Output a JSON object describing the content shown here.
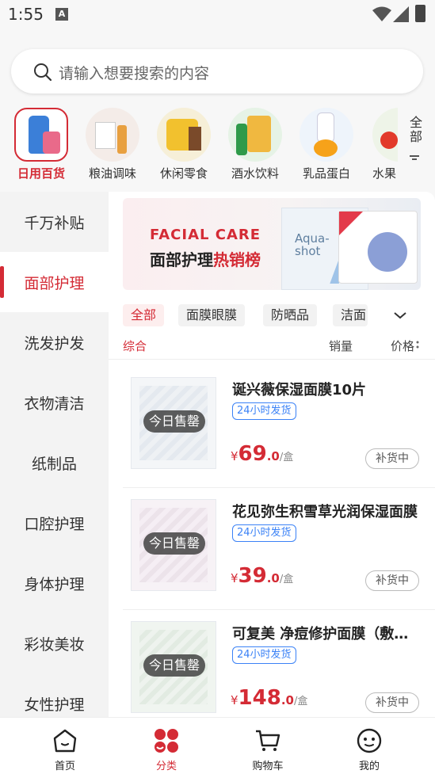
{
  "status_bar": {
    "time": "1:55",
    "notification_badge": "A"
  },
  "search": {
    "placeholder": "请输入想要搜索的内容"
  },
  "top_categories": [
    {
      "label": "日用百货",
      "active": true
    },
    {
      "label": "粮油调味",
      "active": false
    },
    {
      "label": "休闲零食",
      "active": false
    },
    {
      "label": "酒水饮料",
      "active": false
    },
    {
      "label": "乳品蛋白",
      "active": false
    },
    {
      "label": "水果",
      "active": false
    }
  ],
  "all_categories_label": "全部",
  "sidebar": {
    "items": [
      {
        "label": "千万补贴",
        "active": false
      },
      {
        "label": "面部护理",
        "active": true
      },
      {
        "label": "洗发护发",
        "active": false
      },
      {
        "label": "衣物清洁",
        "active": false
      },
      {
        "label": "纸制品",
        "active": false
      },
      {
        "label": "口腔护理",
        "active": false
      },
      {
        "label": "身体护理",
        "active": false
      },
      {
        "label": "彩妆美妆",
        "active": false
      },
      {
        "label": "女性护理",
        "active": false
      }
    ]
  },
  "banner": {
    "en_title": "FACIAL CARE",
    "zh_title": "面部护理",
    "zh_highlight": "热销榜",
    "product_text": "Aqua-shot"
  },
  "filters": [
    {
      "label": "全部",
      "active": true
    },
    {
      "label": "面膜眼膜",
      "active": false
    },
    {
      "label": "防晒品",
      "active": false
    },
    {
      "label": "洁面",
      "active": false
    }
  ],
  "sort": {
    "comprehensive": "综合",
    "sales": "销量",
    "price": "价格"
  },
  "products": [
    {
      "title": "诞兴薇保湿面膜10片",
      "tag": "24小时发货",
      "badge": "今日售罄",
      "currency": "¥",
      "price_int": "69",
      "price_dec": ".0",
      "unit": "/盒",
      "status": "补货中"
    },
    {
      "title": "花见弥生积雪草光润保湿面膜",
      "tag": "24小时发货",
      "badge": "今日售罄",
      "currency": "¥",
      "price_int": "39",
      "price_dec": ".0",
      "unit": "/盒",
      "status": "补货中"
    },
    {
      "title": "可复美 净痘修护面膜（敷料）",
      "tag": "24小时发货",
      "badge": "今日售罄",
      "currency": "¥",
      "price_int": "148",
      "price_dec": ".0",
      "unit": "/盒",
      "status": "补货中"
    }
  ],
  "tabbar": [
    {
      "label": "首页",
      "icon": "home-icon",
      "active": false
    },
    {
      "label": "分类",
      "icon": "category-icon",
      "active": true
    },
    {
      "label": "购物车",
      "icon": "cart-icon",
      "active": false
    },
    {
      "label": "我的",
      "icon": "profile-icon",
      "active": false
    }
  ],
  "colors": {
    "accent": "#d42b35",
    "tag_blue": "#3b82f6",
    "background": "#f7f7f7"
  }
}
